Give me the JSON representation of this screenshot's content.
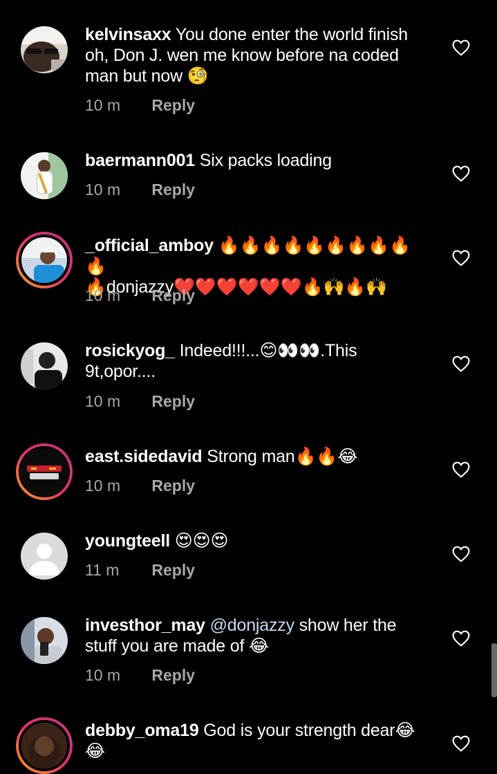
{
  "colors": {
    "background": "#000000",
    "text": "#ffffff",
    "meta": "#a8a8a8",
    "mention": "#c7d7f0",
    "story_ring_start": "#f5a623",
    "story_ring_end": "#c13584"
  },
  "reply_label": "Reply",
  "comments": [
    {
      "username": "kelvinsaxx",
      "text": "You done enter the world finish oh, Don J. wen me know before na coded man but now 🧐",
      "time": "10 m",
      "avatar": "profile-photo-man-with-glasses"
    },
    {
      "username": "baermann001",
      "text": "Six packs loading",
      "time": "10 m",
      "avatar": "profile-photo-saxophonist"
    },
    {
      "username": "_official_amboy",
      "text": "🔥🔥🔥🔥🔥🔥🔥🔥🔥🔥",
      "text2": "🔥donjazzy❤️❤️❤️❤️❤️❤️🔥🙌🔥🙌",
      "time": "10 m",
      "avatar": "profile-photo-man-in-cap"
    },
    {
      "username": "rosickyog_",
      "text": "Indeed!!!...😊👀👀.This",
      "text2": "9t,opor....",
      "time": "10 m",
      "avatar": "profile-photo-bw-portrait"
    },
    {
      "username": "east.sidedavid",
      "text": "Strong man🔥🔥😂",
      "time": "10 m",
      "avatar": "logo-eastside-david"
    },
    {
      "username": "youngteell",
      "text": "😍😍😍",
      "time": "11 m",
      "avatar": "default-avatar"
    },
    {
      "username": "investhor_may",
      "mention": "@donjazzy",
      "text": "show her the stuff you are made of 😂",
      "time": "10 m",
      "avatar": "profile-photo-man-with-phone"
    },
    {
      "username": "debby_oma19",
      "text": "God is your strength dear😂",
      "text2": "😂",
      "time": "",
      "avatar": "profile-photo-woman"
    }
  ]
}
